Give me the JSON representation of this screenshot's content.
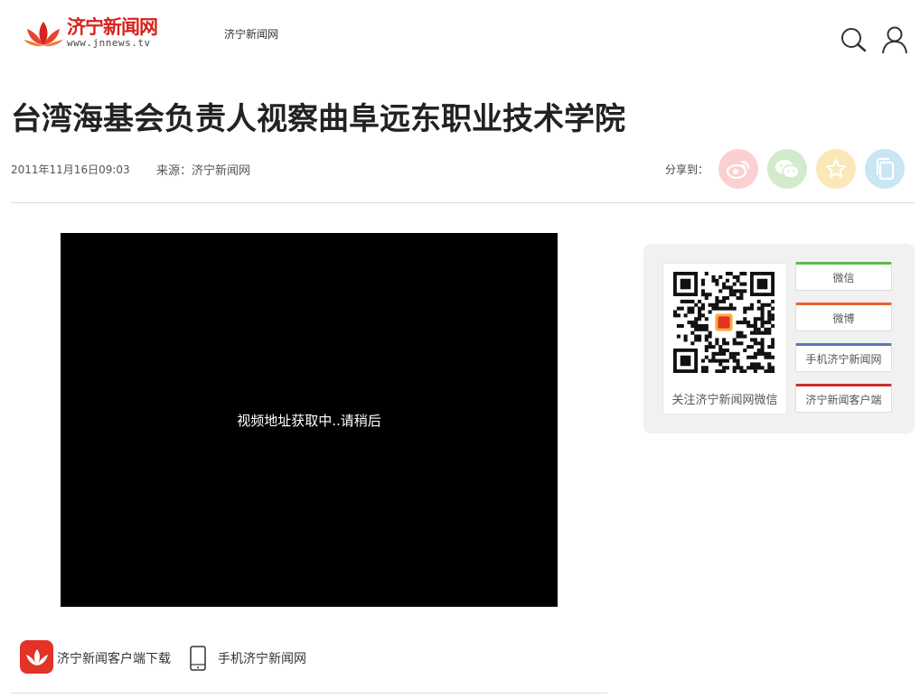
{
  "header": {
    "logo_brand": "济宁新闻网",
    "logo_url": "www.jnnews.tv",
    "nav_link": "济宁新闻网"
  },
  "article": {
    "title": "台湾海基会负责人视察曲阜远东职业技术学院",
    "date": "2011年11月16日09:03",
    "source": "来源：济宁新闻网"
  },
  "share": {
    "label": "分享到：",
    "icons": [
      "weibo-icon",
      "wechat-icon",
      "favorite-icon",
      "copy-icon"
    ]
  },
  "video": {
    "loading_text": "视频地址获取中..请稍后"
  },
  "panel": {
    "qr_caption": "关注济宁新闻网微信",
    "buttons": {
      "wechat": "微信",
      "weibo": "微博",
      "mobile": "手机济宁新闻网",
      "app": "济宁新闻客户端"
    }
  },
  "footer": {
    "app_download": "济宁新闻客户端下载",
    "mobile_site": "手机济宁新闻网"
  },
  "colors": {
    "brand_red": "#d6231b",
    "wechat_green": "#5cba4b",
    "weibo_orange": "#e8652e",
    "mobile_blue": "#4f7bb4",
    "app_red": "#c9302c"
  }
}
